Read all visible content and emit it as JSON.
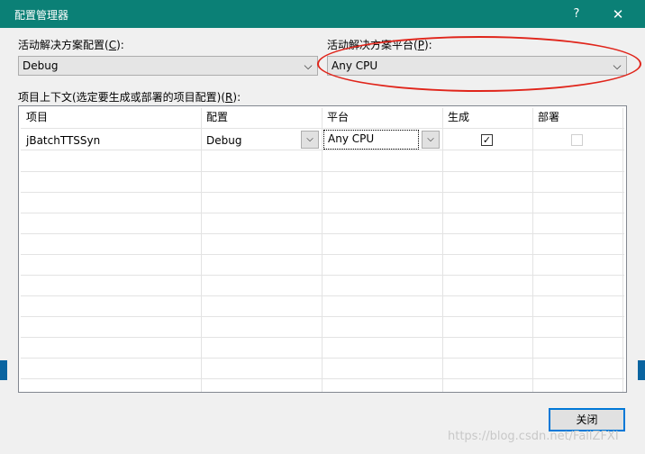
{
  "window": {
    "title": "配置管理器",
    "help_glyph": "?",
    "close_glyph": "✕"
  },
  "config": {
    "label_prefix": "活动解决方案配置(",
    "label_key": "C",
    "label_suffix": "):",
    "value": "Debug"
  },
  "platform": {
    "label_prefix": "活动解决方案平台(",
    "label_key": "P",
    "label_suffix": "):",
    "value": "Any CPU"
  },
  "contexts": {
    "label_prefix": "项目上下文(选定要生成或部署的项目配置)(",
    "label_key": "R",
    "label_suffix": "):",
    "columns": [
      "项目",
      "配置",
      "平台",
      "生成",
      "部署"
    ],
    "rows": [
      {
        "project": "jBatchTTSSyn",
        "configuration": "Debug",
        "platform": "Any CPU",
        "build_checked": true,
        "deploy_checked": false,
        "check_glyph": "✓",
        "arrow_glyph": "⌵"
      }
    ]
  },
  "buttons": {
    "close": "关闭"
  },
  "icons": {
    "dropdown_arrow": "⌵"
  },
  "watermark": "https://blog.csdn.net/FallZFXI",
  "colors": {
    "titlebar": "#0b8076",
    "focus_border": "#0078d7",
    "annotation": "#e0251b"
  }
}
